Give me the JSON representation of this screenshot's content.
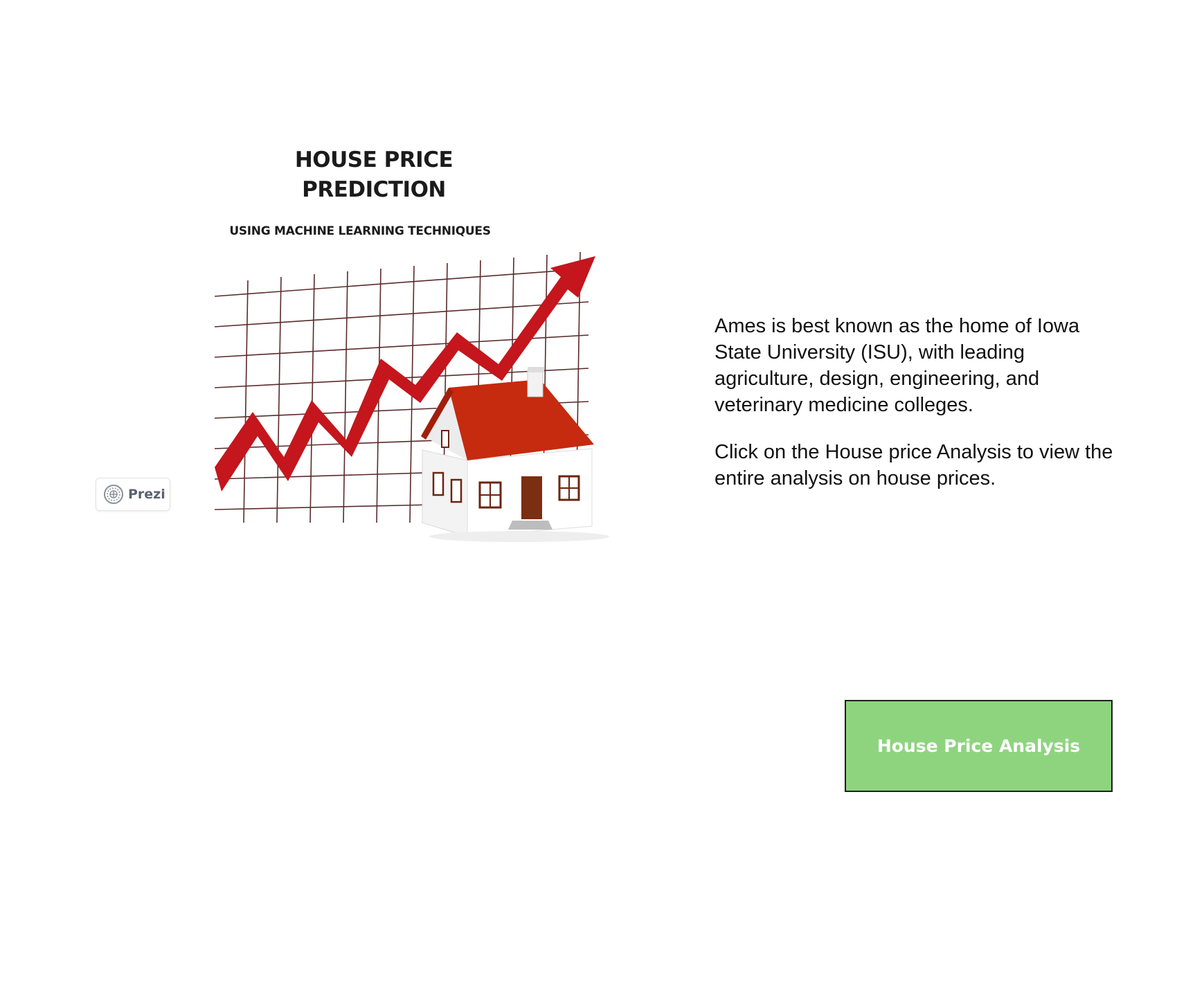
{
  "hero": {
    "title_line1": "HOUSE PRICE",
    "title_line2": "PREDICTION",
    "subtitle": "USING MACHINE LEARNING TECHNIQUES"
  },
  "prezi_badge": {
    "label": "Prezi",
    "icon": "prezi-logo-icon"
  },
  "info": {
    "paragraph1": "Ames is best known as the home of Iowa State University (ISU), with leading agriculture, design, engineering, and veterinary medicine colleges.",
    "paragraph2": "Click on the House price Analysis to view the entire analysis on house prices."
  },
  "analysis_button": {
    "label": "House Price Analysis",
    "background": "#8ed47f"
  },
  "colors": {
    "arrow": "#c4161c",
    "roof": "#c62a0f",
    "grid": "#5a2a2a"
  }
}
